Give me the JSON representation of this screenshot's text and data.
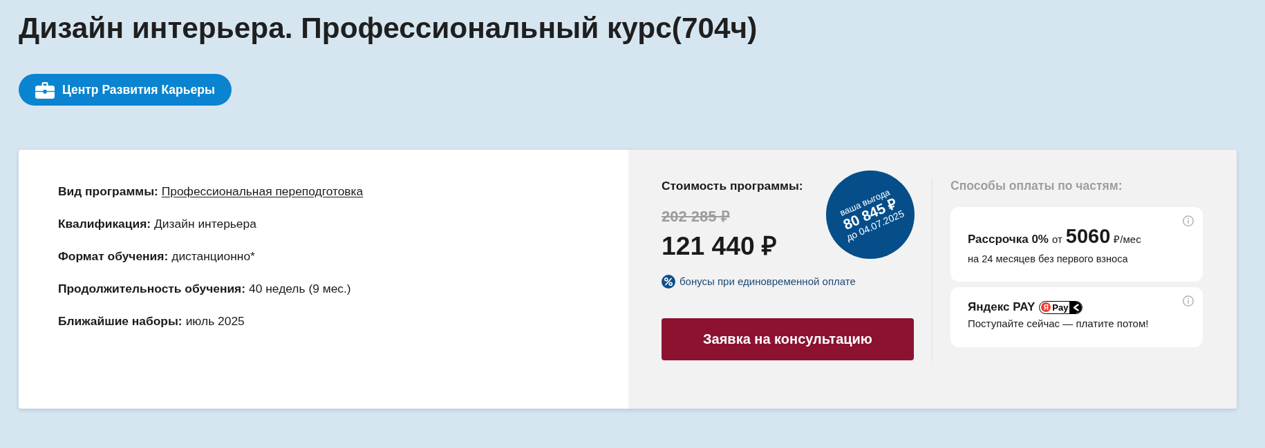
{
  "title": "Дизайн интерьера. Профессиональный курс(704ч)",
  "career_button": {
    "label": "Центр Развития Карьеры"
  },
  "program_info": [
    {
      "label": "Вид программы:",
      "value": "Профессиональная переподготовка",
      "kind": "link"
    },
    {
      "label": "Квалификация:",
      "value": "Дизайн интерьера",
      "kind": "text"
    },
    {
      "label": "Формат обучения:",
      "value": "дистанционно*",
      "kind": "text"
    },
    {
      "label": "Продолжительность обучения:",
      "value": "40 недель (9 мес.)",
      "kind": "text"
    },
    {
      "label": "Ближайшие наборы:",
      "value": "июль 2025",
      "kind": "text"
    }
  ],
  "price": {
    "heading": "Стоимость программы:",
    "old_price": "202 285 ₽",
    "current_price": "121 440 ₽",
    "savings": {
      "caption": "ваша выгода",
      "amount": "80 845 ₽",
      "deadline": "до 04.07.2025"
    },
    "bonus_note": "бонусы при единовременной оплате",
    "cta_button": "Заявка на консультацию"
  },
  "payment": {
    "heading": "Способы оплаты по частям:",
    "options": [
      {
        "kind": "installment",
        "title": "Рассрочка 0%",
        "prefix": "от",
        "amount": "5060",
        "unit": "₽/мес",
        "note": "на 24 месяцев без первого взноса"
      },
      {
        "kind": "wallet",
        "title": "Яндекс PAY",
        "badge_letter": "Я",
        "badge_text": "Pay",
        "note": "Поступайте сейчас — платите потом!"
      }
    ]
  }
}
